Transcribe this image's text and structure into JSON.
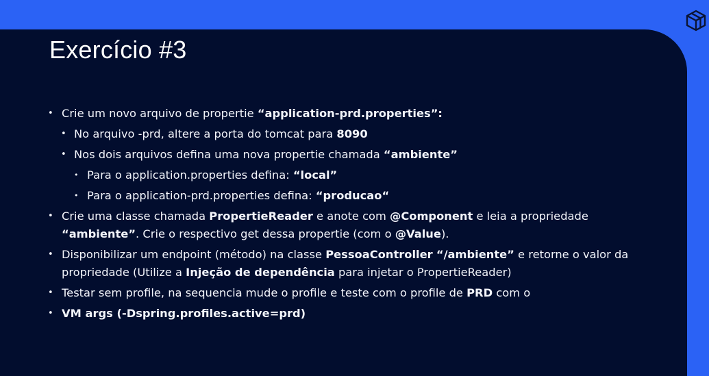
{
  "slide": {
    "title": "Exercício #3",
    "logo_icon": "cube-logo-icon",
    "colors": {
      "accent": "#2b62f5",
      "background": "#020d2e",
      "text": "#ffffff"
    },
    "bullets": [
      {
        "level": 1,
        "parts": [
          {
            "text": "Crie um novo arquivo de propertie ",
            "bold": false
          },
          {
            "text": "“application-prd.properties”:",
            "bold": true
          }
        ]
      },
      {
        "level": 2,
        "parts": [
          {
            "text": "No arquivo -prd, altere a porta do tomcat para ",
            "bold": false
          },
          {
            "text": "8090",
            "bold": true
          }
        ]
      },
      {
        "level": 2,
        "parts": [
          {
            "text": "Nos dois arquivos defina uma nova propertie chamada ",
            "bold": false
          },
          {
            "text": "“ambiente”",
            "bold": true
          }
        ]
      },
      {
        "level": 3,
        "parts": [
          {
            "text": "Para o application.properties defina: ",
            "bold": false
          },
          {
            "text": "“local”",
            "bold": true
          }
        ]
      },
      {
        "level": 3,
        "parts": [
          {
            "text": "Para o application-prd.properties defina: ",
            "bold": false
          },
          {
            "text": "“producao“",
            "bold": true
          }
        ]
      },
      {
        "level": 1,
        "parts": [
          {
            "text": "Crie uma classe chamada ",
            "bold": false
          },
          {
            "text": "PropertieReader",
            "bold": true
          },
          {
            "text": " e anote com ",
            "bold": false
          },
          {
            "text": "@Component",
            "bold": true
          },
          {
            "text": " e leia a propriedade ",
            "bold": false
          },
          {
            "text": "“ambiente”",
            "bold": true
          },
          {
            "text": ". Crie o respectivo get dessa propertie (com o ",
            "bold": false
          },
          {
            "text": "@Value",
            "bold": true
          },
          {
            "text": ").",
            "bold": false
          }
        ]
      },
      {
        "level": 1,
        "parts": [
          {
            "text": "Disponibilizar um endpoint (método) na classe ",
            "bold": false
          },
          {
            "text": "PessoaController",
            "bold": true
          },
          {
            "text": " ",
            "bold": false
          },
          {
            "text": "“/ambiente”",
            "bold": true
          },
          {
            "text": " e retorne o valor da propriedade (Utilize a ",
            "bold": false
          },
          {
            "text": "Injeção de dependência",
            "bold": true
          },
          {
            "text": " para injetar o PropertieReader)",
            "bold": false
          }
        ]
      },
      {
        "level": 1,
        "parts": [
          {
            "text": "Testar sem profile, na sequencia mude o profile e teste com o profile de ",
            "bold": false
          },
          {
            "text": "PRD",
            "bold": true
          },
          {
            "text": " com o",
            "bold": false
          }
        ]
      },
      {
        "level": 1,
        "parts": [
          {
            "text": "VM args (-Dspring.profiles.active=prd)",
            "bold": true
          }
        ]
      }
    ]
  }
}
